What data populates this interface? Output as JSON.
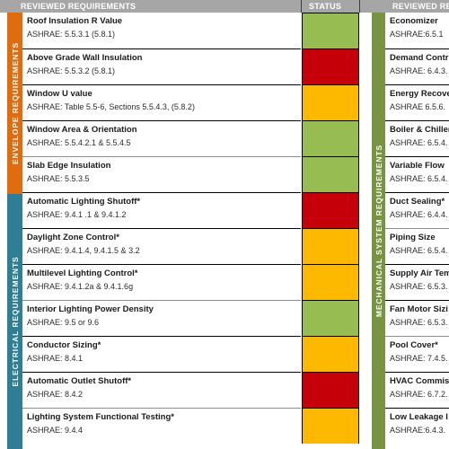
{
  "header": {
    "left_label": "REVIEWED REQUIREMENTS",
    "status_label": "STATUS",
    "right_label": "REVIEWED REQ"
  },
  "colors": {
    "header_band": "#a6a6a6",
    "envelope_band": "#E06C10",
    "electrical_band": "#2E7F95",
    "mechanical_band": "#779440",
    "status_green": "#97BD52",
    "status_red": "#C60008",
    "status_amber": "#FCB900"
  },
  "sections": {
    "envelope": "ENVELOPE REQUIREMENTS",
    "electrical": "ELECTRICAL REQUIREMENTS",
    "mechanical": "MECHANICAL SYSTEM REQUIREMENTS"
  },
  "left_rows": [
    {
      "title": "Roof Insulation R Value",
      "ref": "ASHRAE: 5.5.3.1 (5.8.1)",
      "status": "green"
    },
    {
      "title": "Above Grade Wall Insulation",
      "ref": " ASHRAE: 5.5.3.2 (5.8.1)",
      "status": "red"
    },
    {
      "title": "Window U value",
      "ref": "ASHRAE: Table 5.5-6, Sections 5.5.4.3, (5.8.2)",
      "status": "amber"
    },
    {
      "title": "Window Area & Orientation",
      "ref": "ASHRAE: 5.5.4.2.1 & 5.5.4.5",
      "status": "green"
    },
    {
      "title": "Slab Edge Insulation",
      "ref": "ASHRAE: 5.5.3.5",
      "status": "green"
    },
    {
      "title": "Automatic Lighting Shutoff*",
      "ref": "ASHRAE: 9.4.1 .1 & 9.4.1.2",
      "status": "red"
    },
    {
      "title": "Daylight Zone Control*",
      "ref": "ASHRAE: 9.4.1.4, 9.4.1.5 & 3.2",
      "status": "amber"
    },
    {
      "title": "Multilevel Lighting Control*",
      "ref": "ASHRAE:  9.4.1.2a & 9.4.1.6g",
      "status": "amber"
    },
    {
      "title": "Interior Lighting Power Density",
      "ref": "ASHRAE: 9.5 or 9.6",
      "status": "green"
    },
    {
      "title": "Conductor Sizing*",
      "ref": "ASHRAE: 8.4.1",
      "status": "amber"
    },
    {
      "title": "Automatic Outlet Shutoff*",
      "ref": "ASHRAE: 8.4.2",
      "status": "red"
    },
    {
      "title": "Lighting System Functional Testing*",
      "ref": "ASHRAE: 9.4.4",
      "status": "amber"
    }
  ],
  "right_rows": [
    {
      "title": "Economizer",
      "ref": "ASHRAE:6.5.1"
    },
    {
      "title": "Demand Contr",
      "ref": "ASHRAE: 6.4.3."
    },
    {
      "title": "Energy Recove",
      "ref": "ASHRAE 6.5.6."
    },
    {
      "title": "Boiler & Chiller",
      "ref": "ASHRAE: 6.5.4."
    },
    {
      "title": "Variable Flow",
      "ref": "ASHRAE: 6.5.4."
    },
    {
      "title": "Duct Sealing*",
      "ref": "ASHRAE: 6.4.4."
    },
    {
      "title": "Piping Size",
      "ref": "ASHRAE: 6.5.4."
    },
    {
      "title": "Supply Air Tem",
      "ref": "ASHRAE: 6.5.3."
    },
    {
      "title": "Fan Motor Sizi",
      "ref": "ASHRAE: 6.5.3."
    },
    {
      "title": "Pool Cover*",
      "ref": "ASHRAE: 7.4.5."
    },
    {
      "title": "HVAC Commis",
      "ref": "ASHRAE: 6.7.2."
    },
    {
      "title": "Low Leakage I",
      "ref": "ASHRAE:6.4.3."
    }
  ]
}
